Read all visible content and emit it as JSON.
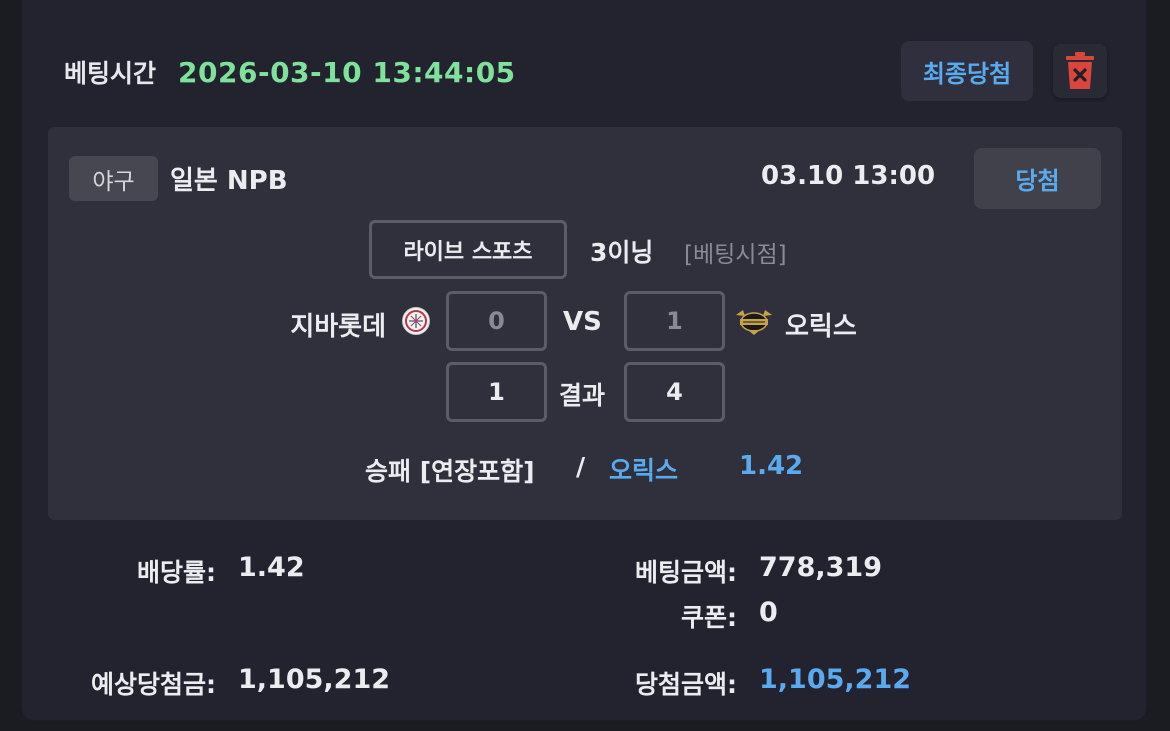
{
  "header": {
    "bet_time_label": "베팅시간",
    "bet_time_value": "2026-03-10 13:44:05",
    "final_win_label": "최종당첨",
    "delete_icon": "trash-icon"
  },
  "match": {
    "sport": "야구",
    "league": "일본 NPB",
    "datetime": "03.10 13:00",
    "status": "당첨",
    "live_tag": "라이브 스포츠",
    "inning": "3이닝",
    "bet_point": "[베팅시점]",
    "home_team": "지바롯데",
    "away_team": "오릭스",
    "home_logo_icon": "marines-logo-icon",
    "away_logo_icon": "buffaloes-logo-icon",
    "vs_label": "VS",
    "result_label": "결과",
    "bet_score_home": "0",
    "bet_score_away": "1",
    "final_score_home": "1",
    "final_score_away": "4",
    "market": "승패 [연장포함]",
    "separator": "/",
    "pick": "오릭스",
    "pick_odds": "1.42"
  },
  "summary": {
    "odds_label": "배당률:",
    "odds_value": "1.42",
    "expected_win_label": "예상당첨금:",
    "expected_win_value": "1,105,212",
    "bet_amount_label": "베팅금액:",
    "bet_amount_value": "778,319",
    "coupon_label": "쿠폰:",
    "coupon_value": "0",
    "win_amount_label": "당첨금액:",
    "win_amount_value": "1,105,212"
  },
  "colors": {
    "accent_blue": "#5aaaf0",
    "time_green": "#7fe29a",
    "trash_red": "#d9463b"
  }
}
